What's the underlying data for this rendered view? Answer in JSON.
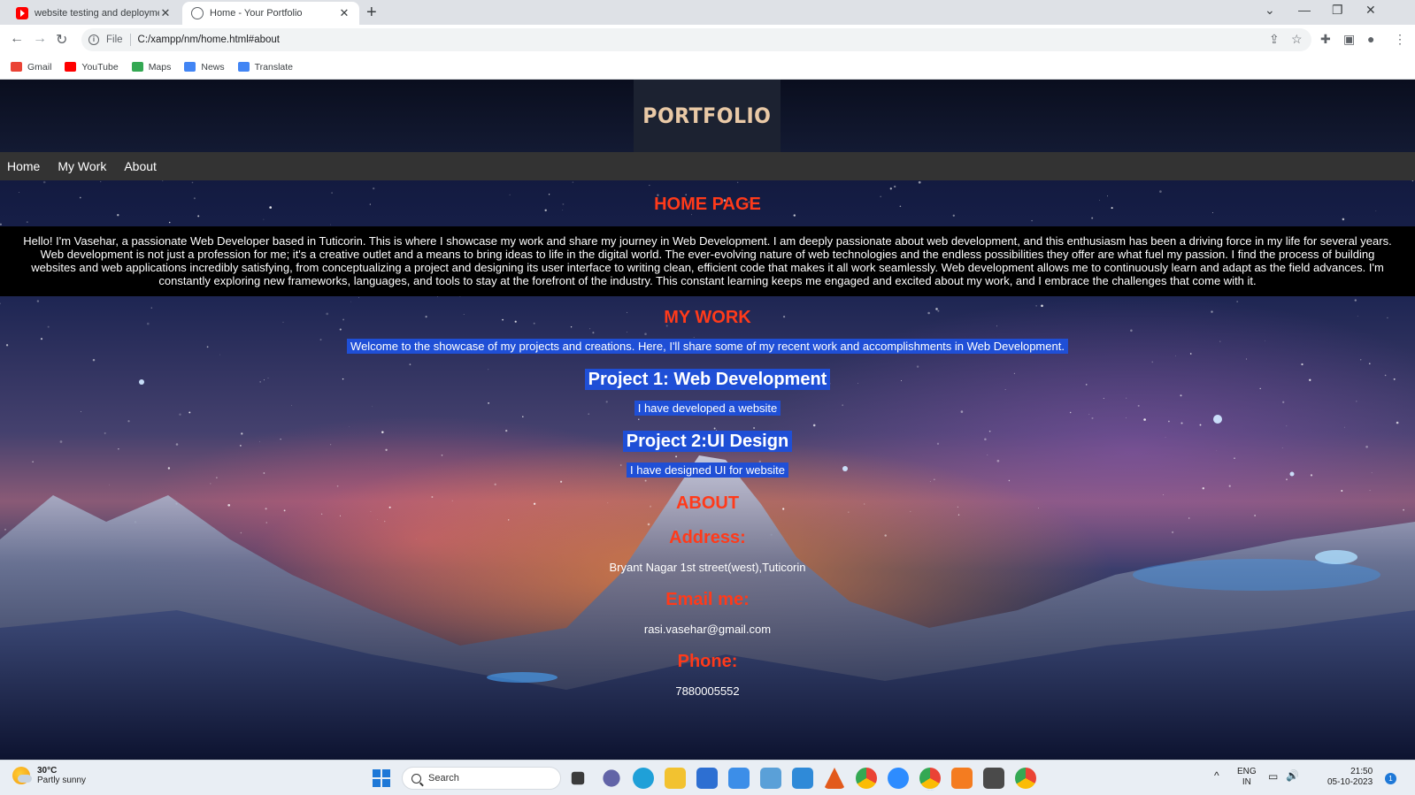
{
  "browser": {
    "tabs": [
      {
        "title": "website testing and deployment",
        "active": false,
        "icon": "youtube-icon"
      },
      {
        "title": "Home - Your Portfolio",
        "active": true,
        "icon": "globe-icon"
      }
    ],
    "new_tab": "+",
    "address": {
      "scheme": "File",
      "url": "C:/xampp/nm/home.html#about"
    },
    "bookmarks": [
      {
        "label": "Gmail",
        "color": "#ea4335"
      },
      {
        "label": "YouTube",
        "color": "#ff0000"
      },
      {
        "label": "Maps",
        "color": "#34a853"
      },
      {
        "label": "News",
        "color": "#4285f4"
      },
      {
        "label": "Translate",
        "color": "#4285f4"
      }
    ]
  },
  "site": {
    "logo": "PORTFOLIO",
    "nav": [
      "Home",
      "My Work",
      "About"
    ],
    "home": {
      "title": "HOME PAGE",
      "text": "Hello! I'm Vasehar, a passionate Web Developer based in Tuticorin. This is where I showcase my work and share my journey in Web Development. I am deeply passionate about web development, and this enthusiasm has been a driving force in my life for several years. Web development is not just a profession for me; it's a creative outlet and a means to bring ideas to life in the digital world. The ever-evolving nature of web technologies and the endless possibilities they offer are what fuel my passion. I find the process of building websites and web applications incredibly satisfying, from conceptualizing a project and designing its user interface to writing clean, efficient code that makes it all work seamlessly. Web development allows me to continuously learn and adapt as the field advances. I'm constantly exploring new frameworks, languages, and tools to stay at the forefront of the industry. This constant learning keeps me engaged and excited about my work, and I embrace the challenges that come with it."
    },
    "work": {
      "title": "MY WORK",
      "intro": "Welcome to the showcase of my projects and creations. Here, I'll share some of my recent work and accomplishments in Web Development.",
      "projects": [
        {
          "title": "Project 1: Web Development",
          "text": "I have developed a website"
        },
        {
          "title": "Project 2:UI Design",
          "text": "I have designed UI for website"
        }
      ]
    },
    "about": {
      "title": "ABOUT",
      "address_label": "Address:",
      "address": "Bryant Nagar 1st street(west),Tuticorin",
      "email_label": "Email me:",
      "email": "rasi.vasehar@gmail.com",
      "phone_label": "Phone:",
      "phone": "7880005552"
    },
    "colors": {
      "heading": "#ff3a1a",
      "selection": "#1f4fd6",
      "navbar": "#333333"
    }
  },
  "taskbar": {
    "weather": {
      "temp": "30°C",
      "desc": "Partly sunny"
    },
    "search_placeholder": "Search",
    "lang": {
      "line1": "ENG",
      "line2": "IN"
    },
    "clock": {
      "time": "21:50",
      "date": "05-10-2023"
    },
    "notifications": "1"
  }
}
